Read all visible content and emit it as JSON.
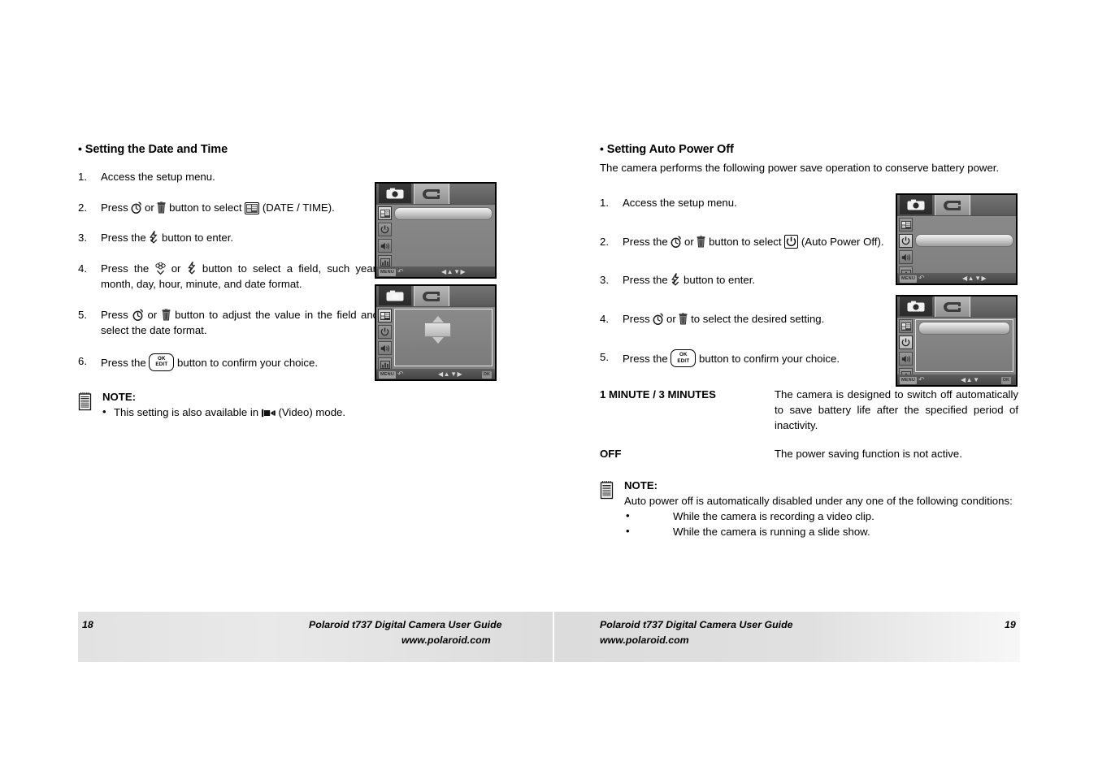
{
  "document": {
    "title": "Polaroid t737 Digital Camera User Guide",
    "url": "www.polaroid.com"
  },
  "left_page": {
    "number": "18",
    "heading": "Setting the Date and Time",
    "bullet": "•",
    "steps": [
      {
        "num": "1.",
        "text_a": "Access the setup menu."
      },
      {
        "num": "2.",
        "text_a": "Press ",
        "text_b": " or ",
        "text_c": " button to select ",
        "text_d": " (DATE / TIME)."
      },
      {
        "num": "3.",
        "text_a": "Press the ",
        "text_b": " button to enter."
      },
      {
        "num": "4.",
        "text_a": "Press the ",
        "text_b": " or ",
        "text_c": " button to select a field, such year, month, day, hour, minute, and date format."
      },
      {
        "num": "5.",
        "text_a": "Press ",
        "text_b": " or ",
        "text_c": " button to adjust the value in the field and select the date format."
      },
      {
        "num": "6.",
        "text_a": "Press the ",
        "text_b": " button to confirm your choice."
      }
    ],
    "note": {
      "title": "NOTE:",
      "item_a": "This setting is also available in ",
      "item_b": " (Video) mode."
    }
  },
  "right_page": {
    "number": "19",
    "heading": "Setting Auto Power Off",
    "bullet": "•",
    "intro": "The camera performs the following power save operation to conserve battery power.",
    "steps": [
      {
        "num": "1.",
        "text_a": "Access the setup menu."
      },
      {
        "num": "2.",
        "text_a": "Press the ",
        "text_b": " or ",
        "text_c": " button to select ",
        "text_d": " (Auto Power Off)."
      },
      {
        "num": "3.",
        "text_a": "Press the ",
        "text_b": " button to enter."
      },
      {
        "num": "4.",
        "text_a": "Press ",
        "text_b": " or ",
        "text_c": " to select the desired setting."
      },
      {
        "num": "5.",
        "text_a": "Press the ",
        "text_b": " button to confirm your choice."
      }
    ],
    "definitions": [
      {
        "term": "1 MINUTE / 3 MINUTES",
        "desc": "The camera is designed to switch off automatically to save battery life after the specified period of inactivity."
      },
      {
        "term": "OFF",
        "desc": "The power saving function is not active."
      }
    ],
    "note": {
      "title": "NOTE:",
      "body": "Auto power off is automatically disabled under any one of the following conditions:",
      "items": [
        "While the camera is recording a video clip.",
        "While the camera is running a slide show."
      ]
    }
  },
  "lcd_screens": [
    {
      "id": "left-screen-1",
      "tabs": [
        "capture-mode-tab",
        "setup-mode-tab"
      ],
      "selected_tab": "setup-mode-tab",
      "menu_icons": [
        "date-time-icon",
        "auto-power-off-icon",
        "beep-volume-icon",
        "lcd-brightness-icon",
        "format-reset-icon"
      ],
      "highlighted_row": 0,
      "status": {
        "menu_label": "MENU",
        "back": "↶",
        "arrows": "◀▲▼▶",
        "ok_label": ""
      }
    },
    {
      "id": "left-screen-2",
      "tabs": [
        "capture-mode-tab",
        "setup-mode-tab"
      ],
      "selected_tab": "setup-mode-tab",
      "menu_icons": [
        "date-time-icon",
        "auto-power-off-icon",
        "beep-volume-icon",
        "lcd-brightness-icon",
        "format-reset-icon"
      ],
      "highlighted_row": -1,
      "has_dialog": true,
      "status": {
        "menu_label": "MENU",
        "back": "↶",
        "arrows": "◀▲▼▶",
        "ok_label": "OK"
      }
    },
    {
      "id": "right-screen-1",
      "tabs": [
        "capture-mode-tab",
        "setup-mode-tab"
      ],
      "selected_tab": "setup-mode-tab",
      "menu_icons": [
        "date-time-icon",
        "auto-power-off-icon",
        "beep-volume-icon",
        "lcd-brightness-icon",
        "format-reset-icon"
      ],
      "highlighted_row": 1,
      "status": {
        "menu_label": "MENU",
        "back": "↶",
        "arrows": "◀▲▼▶",
        "ok_label": ""
      }
    },
    {
      "id": "right-screen-2",
      "tabs": [
        "capture-mode-tab",
        "setup-mode-tab"
      ],
      "selected_tab": "setup-mode-tab",
      "menu_icons": [
        "date-time-icon",
        "auto-power-off-icon",
        "beep-volume-icon",
        "lcd-brightness-icon",
        "format-reset-icon"
      ],
      "highlighted_row": 0,
      "selected_side_icon": 1,
      "status": {
        "menu_label": "MENU",
        "back": "↶",
        "arrows": "◀▲▼",
        "ok_label": "OK"
      }
    }
  ],
  "colors": {
    "page_background": "#ffffff",
    "text": "#000000",
    "footer_gradient_start": "#e2e2e2",
    "footer_gradient_end": "#f7f7f7",
    "lcd_body": "#808080",
    "lcd_border": "#000000"
  }
}
